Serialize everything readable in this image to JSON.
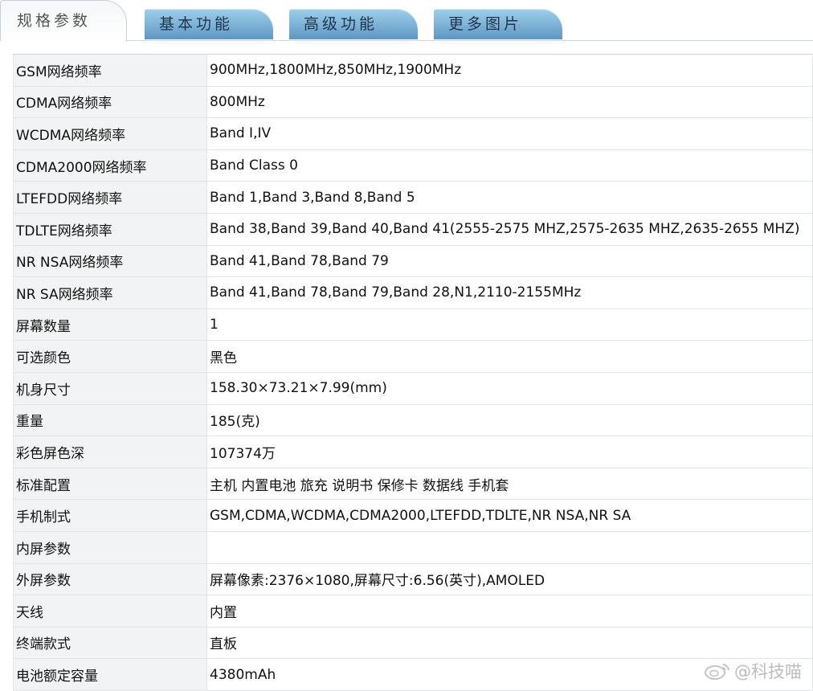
{
  "tabs": [
    {
      "label": "规格参数"
    },
    {
      "label": "基本功能"
    },
    {
      "label": "高级功能"
    },
    {
      "label": "更多图片"
    }
  ],
  "specs": [
    {
      "label": "GSM网络频率",
      "value": "900MHz,1800MHz,850MHz,1900MHz"
    },
    {
      "label": "CDMA网络频率",
      "value": "800MHz"
    },
    {
      "label": "WCDMA网络频率",
      "value": "Band Ⅰ,IV"
    },
    {
      "label": "CDMA2000网络频率",
      "value": "Band Class 0"
    },
    {
      "label": "LTEFDD网络频率",
      "value": "Band 1,Band 3,Band 8,Band 5"
    },
    {
      "label": "TDLTE网络频率",
      "value": "Band 38,Band 39,Band 40,Band 41(2555-2575 MHZ,2575-2635 MHZ,2635-2655 MHZ)"
    },
    {
      "label": "NR NSA网络频率",
      "value": "Band 41,Band 78,Band 79"
    },
    {
      "label": "NR SA网络频率",
      "value": "Band 41,Band 78,Band 79,Band 28,N1,2110-2155MHz"
    },
    {
      "label": "屏幕数量",
      "value": "1"
    },
    {
      "label": "可选颜色",
      "value": "黑色"
    },
    {
      "label": "机身尺寸",
      "value": "158.30×73.21×7.99(mm)"
    },
    {
      "label": "重量",
      "value": "185(克)"
    },
    {
      "label": "彩色屏色深",
      "value": "107374万"
    },
    {
      "label": "标准配置",
      "value": "主机 内置电池 旅充 说明书 保修卡 数据线 手机套"
    },
    {
      "label": "手机制式",
      "value": "GSM,CDMA,WCDMA,CDMA2000,LTEFDD,TDLTE,NR NSA,NR SA"
    },
    {
      "label": "内屏参数",
      "value": ""
    },
    {
      "label": "外屏参数",
      "value": "屏幕像素:2376×1080,屏幕尺寸:6.56(英寸),AMOLED"
    },
    {
      "label": "天线",
      "value": "内置"
    },
    {
      "label": "终端款式",
      "value": "直板"
    },
    {
      "label": "电池额定容量",
      "value": "4380mAh"
    }
  ],
  "watermark": {
    "text": "@科技喵",
    "icon": "weibo-icon"
  }
}
